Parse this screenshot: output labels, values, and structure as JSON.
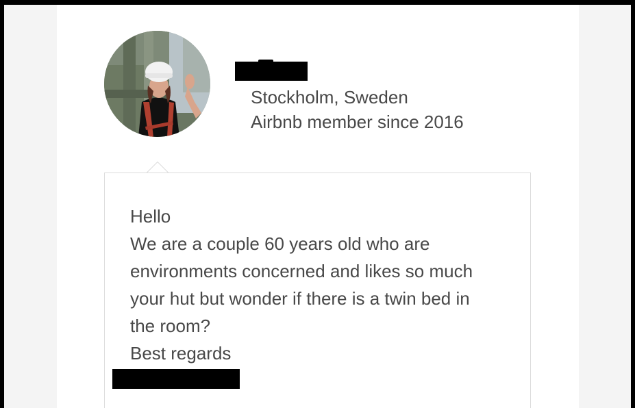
{
  "host": {
    "location": "Stockholm, Sweden",
    "member_since": "Airbnb member since 2016"
  },
  "message": {
    "lines": [
      "Hello",
      "We are a couple 60 years old who are",
      "environments concerned and likes so much",
      "your hut but wonder if there is a twin bed in",
      "the room?",
      "Best regards"
    ]
  },
  "colors": {
    "text": "#484848",
    "border": "#dcdcdc",
    "background": "#f4f4f4",
    "card": "#ffffff"
  }
}
